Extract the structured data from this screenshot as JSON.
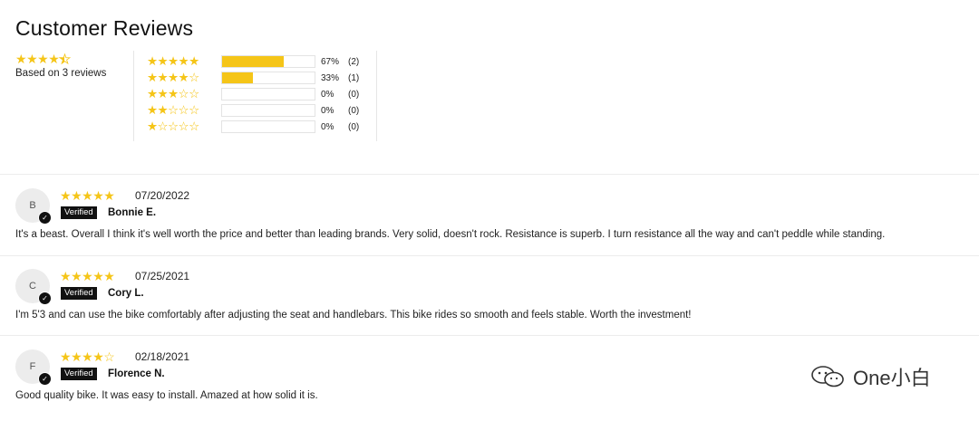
{
  "page": {
    "title": "Customer Reviews"
  },
  "summary": {
    "average_rating": 4.5,
    "based_on": "Based on 3 reviews"
  },
  "histogram": [
    {
      "stars": 5,
      "percent": 67,
      "percent_label": "67%",
      "count_label": "(2)"
    },
    {
      "stars": 4,
      "percent": 33,
      "percent_label": "33%",
      "count_label": "(1)"
    },
    {
      "stars": 3,
      "percent": 0,
      "percent_label": "0%",
      "count_label": "(0)"
    },
    {
      "stars": 2,
      "percent": 0,
      "percent_label": "0%",
      "count_label": "(0)"
    },
    {
      "stars": 1,
      "percent": 0,
      "percent_label": "0%",
      "count_label": "(0)"
    }
  ],
  "reviews": [
    {
      "initial": "B",
      "rating": 5,
      "date": "07/20/2022",
      "verified_label": "Verified",
      "name": "Bonnie E.",
      "text": "It's a beast. Overall I think it's well worth the price and better than leading brands. Very solid, doesn't rock. Resistance is superb. I turn resistance all the way and can't peddle while standing."
    },
    {
      "initial": "C",
      "rating": 5,
      "date": "07/25/2021",
      "verified_label": "Verified",
      "name": "Cory L.",
      "text": "I'm 5'3 and can use the bike comfortably after adjusting the seat and handlebars. This bike rides so smooth and feels stable. Worth the investment!"
    },
    {
      "initial": "F",
      "rating": 4,
      "date": "02/18/2021",
      "verified_label": "Verified",
      "name": "Florence N.",
      "text": "Good quality bike. It was easy to install. Amazed at how solid it is."
    }
  ],
  "watermark": {
    "text": "One小白",
    "icon": "wechat-icon"
  },
  "colors": {
    "star": "#f5c518",
    "bar_fill": "#f5c518",
    "verified_bg": "#111111"
  }
}
